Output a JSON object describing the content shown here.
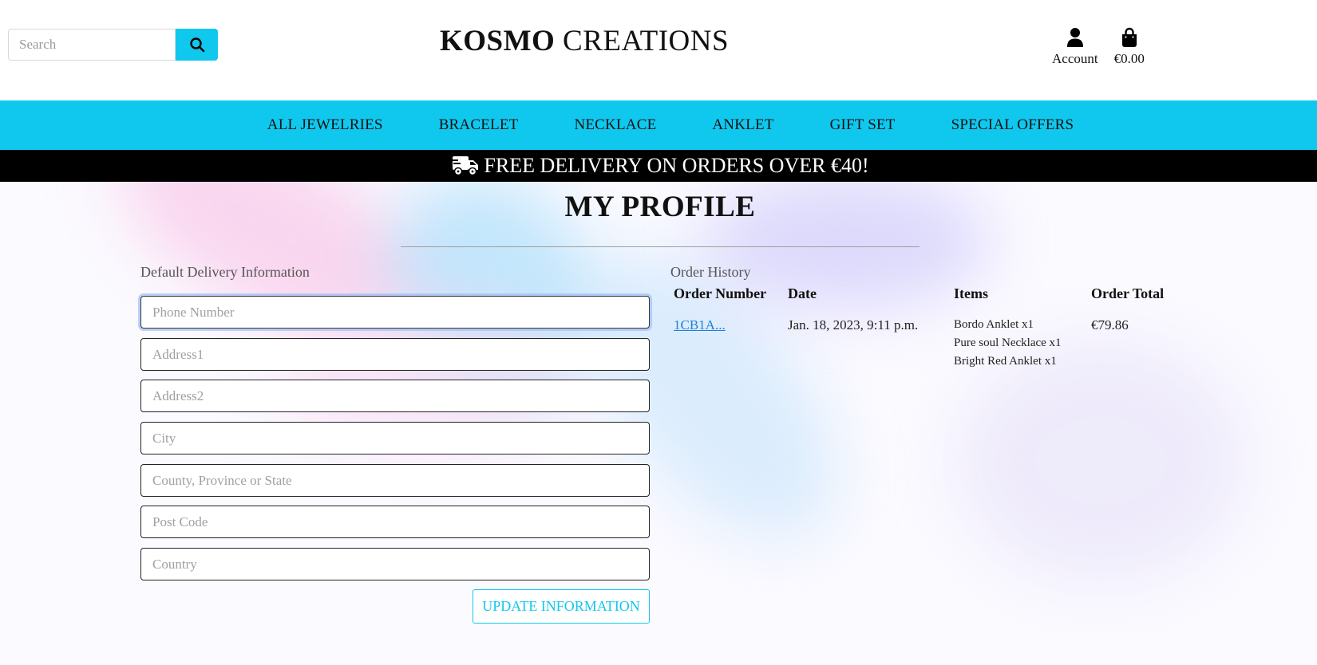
{
  "header": {
    "search_placeholder": "Search",
    "brand_bold": "KOSMO",
    "brand_rest": "CREATIONS",
    "account_label": "Account",
    "cart_total": "€0.00"
  },
  "nav": [
    "ALL JEWELRIES",
    "BRACELET",
    "NECKLACE",
    "ANKLET",
    "GIFT SET",
    "SPECIAL OFFERS"
  ],
  "promo": "FREE DELIVERY ON ORDERS OVER €40!",
  "page_title": "MY PROFILE",
  "delivery": {
    "label": "Default Delivery Information",
    "placeholders": [
      "Phone Number",
      "Address1",
      "Address2",
      "City",
      "County, Province or State",
      "Post Code",
      "Country"
    ],
    "button": "UPDATE INFORMATION"
  },
  "history": {
    "label": "Order History",
    "columns": [
      "Order Number",
      "Date",
      "Items",
      "Order Total"
    ],
    "rows": [
      {
        "number": "1CB1A...",
        "date": "Jan. 18, 2023, 9:11 p.m.",
        "items": [
          "Bordo Anklet x1",
          "Pure soul Necklace x1",
          "Bright Red Anklet x1"
        ],
        "total": "€79.86"
      }
    ]
  },
  "colors": {
    "accent": "#10c8ee",
    "banner": "#000000",
    "link": "#1e7fd8"
  },
  "icons": {
    "search": "search-icon",
    "account": "user-icon",
    "cart": "shopping-bag-icon",
    "delivery": "truck-icon"
  }
}
